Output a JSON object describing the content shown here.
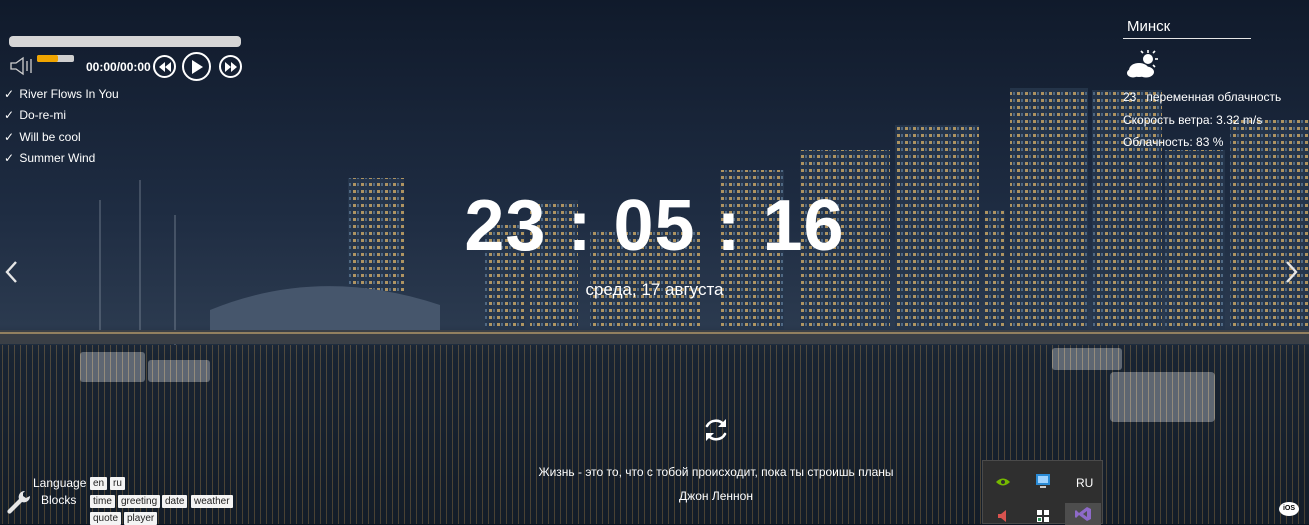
{
  "player": {
    "time": "00:00/00:00",
    "volume_level": 0.58,
    "tracks": [
      {
        "check": "✓",
        "title": "River Flows In You"
      },
      {
        "check": "✓",
        "title": "Do-re-mi"
      },
      {
        "check": "✓",
        "title": "Will be cool"
      },
      {
        "check": "✓",
        "title": "Summer Wind"
      }
    ],
    "icons": {
      "volume": "volume-icon",
      "prev": "rewind-icon",
      "play": "play-icon",
      "next": "fast-forward-icon"
    }
  },
  "weather": {
    "city": "Минск",
    "temperature": "23",
    "condition": "переменная облачность",
    "wind": "Скорость ветра: 3.32 m/s",
    "clouds": "Облачность: 83 %",
    "icon": "partly-cloudy-icon"
  },
  "clock": {
    "time": "23 : 05 : 16",
    "date": "среда, 17 августа"
  },
  "quote": {
    "text": "Жизнь - это то, что с тобой происходит, пока ты строишь планы",
    "author": "Джон Леннон"
  },
  "settings": {
    "language_label": "Language",
    "blocks_label": "Blocks",
    "languages": [
      "en",
      "ru"
    ],
    "blocks": [
      "time",
      "greeting",
      "date",
      "weather",
      "quote",
      "player"
    ]
  },
  "tray": {
    "language": "RU",
    "icons": [
      "nvidia-icon",
      "network-icon",
      "volume-icon",
      "security-icon",
      "visual-studio-icon"
    ]
  },
  "badge": "iOS",
  "colors": {
    "accent": "#f0a500",
    "text": "#ffffff"
  }
}
